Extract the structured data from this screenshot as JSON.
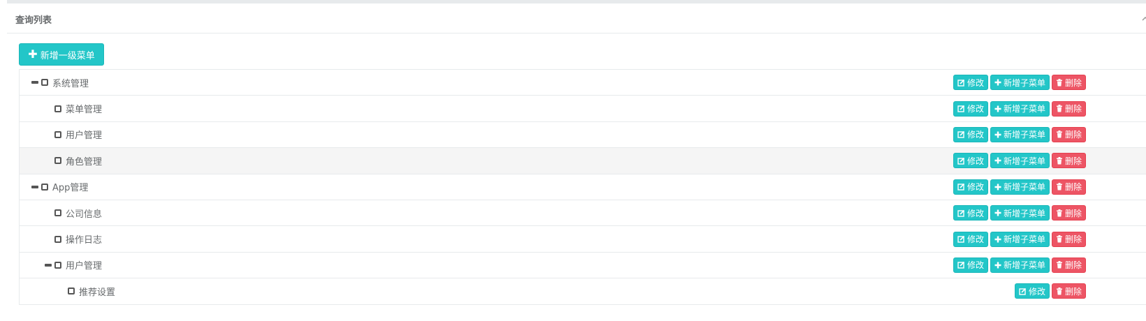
{
  "panel": {
    "title": "查询列表"
  },
  "toolbar": {
    "add_top_label": "新增一级菜单"
  },
  "actions": {
    "edit": "修改",
    "add_child": "新增子菜单",
    "delete": "删除"
  },
  "tree": [
    {
      "label": "系统管理",
      "level": 0,
      "expanded": true,
      "has_add_child": true
    },
    {
      "label": "菜单管理",
      "level": 1,
      "expanded": false,
      "has_add_child": true
    },
    {
      "label": "用户管理",
      "level": 1,
      "expanded": false,
      "has_add_child": true
    },
    {
      "label": "角色管理",
      "level": 1,
      "expanded": false,
      "has_add_child": true,
      "highlighted": true
    },
    {
      "label": "App管理",
      "level": 0,
      "expanded": true,
      "has_add_child": true
    },
    {
      "label": "公司信息",
      "level": 1,
      "expanded": false,
      "has_add_child": true
    },
    {
      "label": "操作日志",
      "level": 1,
      "expanded": false,
      "has_add_child": true
    },
    {
      "label": "用户管理",
      "level": 1,
      "expanded": true,
      "has_add_child": true
    },
    {
      "label": "推荐设置",
      "level": 2,
      "expanded": false,
      "has_add_child": false
    }
  ],
  "colors": {
    "info": "#23c6c8",
    "danger": "#ed5565",
    "row_highlight": "#f5f5f5"
  },
  "icons": {
    "edit": "edit-icon",
    "add": "plus-icon",
    "delete": "trash-icon",
    "collapse": "chevron-up-icon",
    "node_toggle": "minus-icon",
    "node_check": "checkbox-icon"
  }
}
